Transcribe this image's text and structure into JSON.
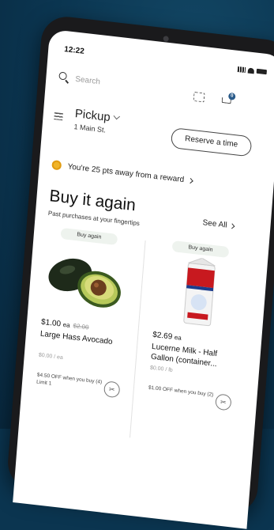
{
  "status": {
    "time": "12:22"
  },
  "search": {
    "placeholder": "Search"
  },
  "header": {
    "cart_count": "0"
  },
  "pickup": {
    "title": "Pickup",
    "store": "1 Main St.",
    "reserve_label": "Reserve a time"
  },
  "reward": {
    "text": "You're 25 pts away from a reward"
  },
  "section": {
    "title": "Buy it again",
    "subtitle": "Past purchases at your fingertips",
    "see_all": "See All"
  },
  "products": [
    {
      "tag": "Buy again",
      "price": "$1.00",
      "unit": "ea",
      "old_price": "$2.00",
      "name": "Large Hass Avocado",
      "size": "$0.00 / ea",
      "offer": "$4.50 OFF when you buy (4) Limit 1"
    },
    {
      "tag": "Buy again",
      "price": "$2.69",
      "unit": "ea",
      "old_price": "",
      "name": "Lucerne Milk - Half Gallon (container...",
      "size": "$0.00 / lb",
      "offer": "$1.00 OFF when you buy (2)"
    }
  ],
  "colors": {
    "accent": "#2a5b8a",
    "background": "#0b3550",
    "reward": "#f0b429"
  }
}
